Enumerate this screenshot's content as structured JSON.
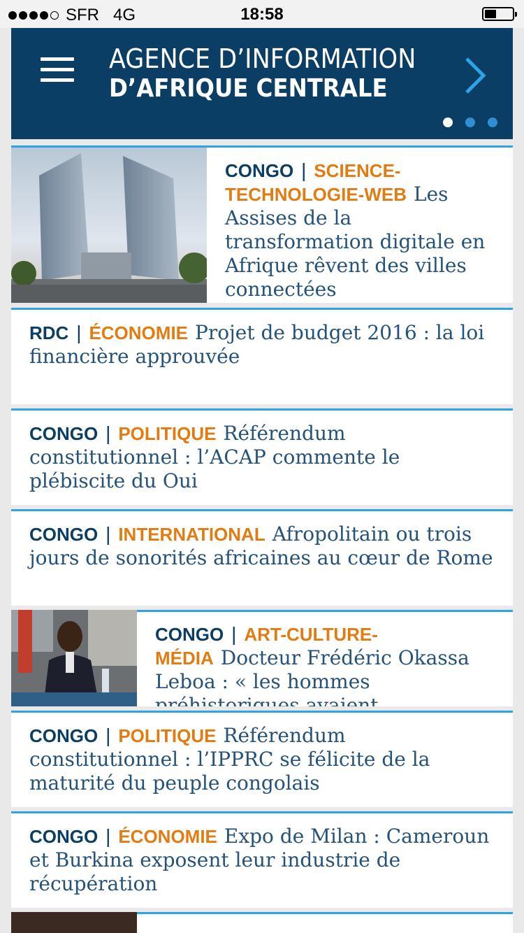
{
  "status_bar": {
    "carrier": "SFR",
    "network": "4G",
    "time": "18:58",
    "signal_bars": 4,
    "battery_level": 0.3
  },
  "header": {
    "logo_line1": "AGENCE D’INFORMATION",
    "logo_line2": "D’AFRIQUE CENTRALE",
    "menu_icon": "hamburger-icon",
    "next_icon": "chevron-right-icon",
    "pager": {
      "count": 3,
      "active": 0
    }
  },
  "articles": [
    {
      "country": "CONGO",
      "category": "SCIENCE-TECHNOLOGIE-WEB",
      "title": "Les Assises de la transformation digitale en Afrique rêvent des villes connectées",
      "has_image": true,
      "image": "skyscrapers-photo"
    },
    {
      "country": "RDC",
      "category": "ÉCONOMIE",
      "title": "Projet de budget 2016 : la loi financière approuvée"
    },
    {
      "country": "CONGO",
      "category": "POLITIQUE",
      "title": "Référendum constitutionnel : l’ACAP commente le plébiscite du Oui"
    },
    {
      "country": "CONGO",
      "category": "INTERNATIONAL",
      "title": "Afropolitain ou trois jours de sonorités africaines au cœur de Rome"
    },
    {
      "country": "CONGO",
      "category": "ART-CULTURE-MÉDIA",
      "title": "Docteur Frédéric Okassa Leboa : « les hommes préhistoriques avaient",
      "has_image": true,
      "image": "speaker-photo"
    },
    {
      "country": "CONGO",
      "category": "POLITIQUE",
      "title": "Référendum constitutionnel : l’IPPRC se félicite de la maturité du peuple congolais"
    },
    {
      "country": "CONGO",
      "category": "ÉCONOMIE",
      "title": "Expo de Milan : Cameroun et Burkina exposent leur industrie de récupération"
    }
  ],
  "separator": "|",
  "colors": {
    "navy": "#0b3e64",
    "accent_blue": "#2ea3e6",
    "orange": "#e37c10"
  }
}
